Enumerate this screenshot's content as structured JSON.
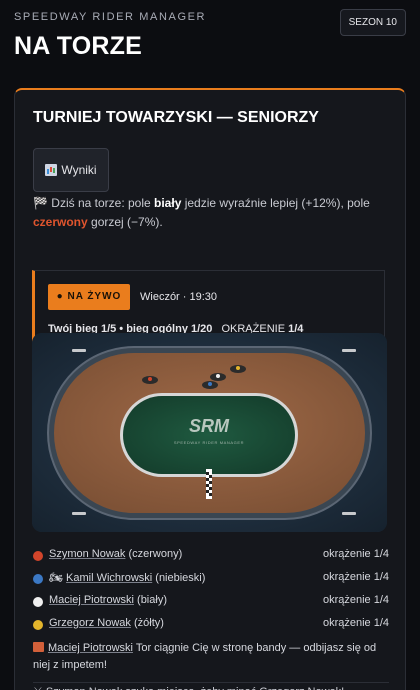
{
  "header": {
    "app_name": "SPEEDWAY RIDER MANAGER",
    "page_title": "NA TORZE",
    "season_button": "SEZON 10"
  },
  "card": {
    "title": "TURNIEJ TOWARZYSKI — SENIORZY",
    "results_button": "Wyniki",
    "track_note": {
      "prefix": "Dziś na torze: pole ",
      "good_gate": "biały",
      "middle": " jedzie wyraźnie lepiej (+12%), pole ",
      "bad_gate": "czerwony",
      "suffix": " gorzej (−7%)."
    },
    "live": {
      "badge": "● NA ŻYWO",
      "time": "Wieczór · 19:30",
      "heat": "Twój bieg 1/5 • bieg ogólny 1/20",
      "lap_label": "OKRĄŻENIE",
      "lap_value": "1/4"
    },
    "track": {
      "logo": "SRM",
      "logo_sub": "SPEEDWAY RIDER MANAGER"
    },
    "riders": [
      {
        "name": "Szymon Nowak",
        "color_label": "(czerwony)",
        "color": "#d2452b",
        "lap": "okrążenie 1/4",
        "mine": false
      },
      {
        "name": "Kamil Wichrowski",
        "color_label": "(niebieski)",
        "color": "#3b78c4",
        "lap": "okrążenie 1/4",
        "mine": true
      },
      {
        "name": "Maciej Piotrowski",
        "color_label": "(biały)",
        "color": "#f0f0f0",
        "lap": "okrążenie 1/4",
        "mine": false
      },
      {
        "name": "Grzegorz Nowak",
        "color_label": "(żółty)",
        "color": "#e3b52c",
        "lap": "okrążenie 1/4",
        "mine": false
      }
    ],
    "event": {
      "rider": "Maciej Piotrowski",
      "text": " Tor ciągnie Cię w stronę bandy — odbijasz się od niej z impetem!"
    },
    "event2": "⚔ Szymon Nowak szuka miejsca, żeby minąć Grzegorz Nowak!"
  },
  "colors": {
    "accent": "#ea7d1d",
    "background": "#0c0d11",
    "card": "#15171c"
  }
}
